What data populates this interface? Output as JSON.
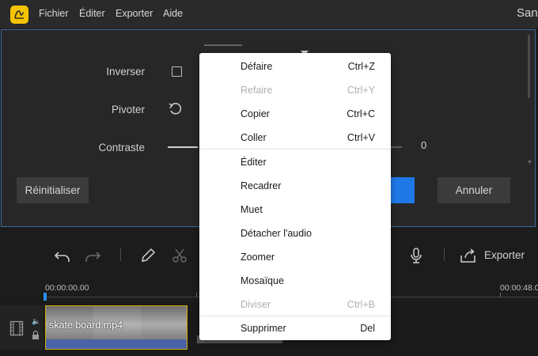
{
  "menubar": {
    "items": [
      "Fichier",
      "Éditer",
      "Exporter",
      "Aide"
    ],
    "window_title": "San"
  },
  "panel": {
    "invert_label": "Inverser",
    "rotate_label": "Pivoter",
    "contrast_label": "Contraste",
    "contrast_value": "0",
    "reset_button": "Réinitialiser",
    "cancel_button": "Annuler"
  },
  "toolbar": {
    "export_label": "Exporter"
  },
  "timeline": {
    "ruler_start": "00:00:00.00",
    "ruler_end": "00:00:48.0",
    "clip_name": "skate board.mp4"
  },
  "context_menu": {
    "group1": [
      {
        "label": "Défaire",
        "shortcut": "Ctrl+Z",
        "enabled": true
      },
      {
        "label": "Refaire",
        "shortcut": "Ctrl+Y",
        "enabled": false
      },
      {
        "label": "Copier",
        "shortcut": "Ctrl+C",
        "enabled": true
      },
      {
        "label": "Coller",
        "shortcut": "Ctrl+V",
        "enabled": true
      }
    ],
    "group2": [
      {
        "label": "Éditer",
        "shortcut": "",
        "enabled": true
      },
      {
        "label": "Recadrer",
        "shortcut": "",
        "enabled": true
      },
      {
        "label": "Muet",
        "shortcut": "",
        "enabled": true
      },
      {
        "label": "Détacher l'audio",
        "shortcut": "",
        "enabled": true
      },
      {
        "label": "Zoomer",
        "shortcut": "",
        "enabled": true
      },
      {
        "label": "Mosaïque",
        "shortcut": "",
        "enabled": true
      },
      {
        "label": "Diviser",
        "shortcut": "Ctrl+B",
        "enabled": false
      }
    ],
    "group3": [
      {
        "label": "Supprimer",
        "shortcut": "Del",
        "enabled": true
      }
    ]
  },
  "colors": {
    "accent": "#1e78e6",
    "logo": "#f5c400",
    "clip_border": "#d0b000",
    "audio_track": "#4a62a8"
  }
}
